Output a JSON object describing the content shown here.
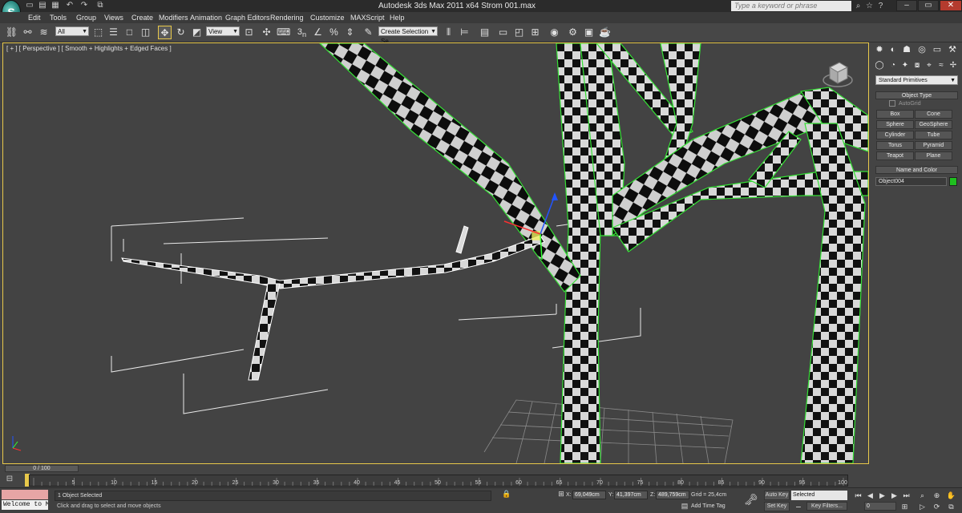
{
  "window": {
    "title": "Autodesk 3ds Max 2011 x64     Strom 001.max",
    "search_placeholder": "Type a keyword or phrase",
    "app_logo_letter": "S"
  },
  "menu": [
    "Edit",
    "Tools",
    "Group",
    "Views",
    "Create",
    "Modifiers",
    "Animation",
    "Graph Editors",
    "Rendering",
    "Customize",
    "MAXScript",
    "Help"
  ],
  "toolbar": {
    "selection_filter": "All",
    "ref_coord": "View",
    "named_selection": "Create Selection Se",
    "snap_label": "3",
    "snap_sub": "n"
  },
  "viewport": {
    "label": "[ + ] [ Perspective ] [ Smooth + Highlights + Edged Faces ]",
    "border_color": "#e8c84a"
  },
  "command_panel": {
    "category": "Standard Primitives",
    "object_type_header": "Object Type",
    "autogrid": "AutoGrid",
    "buttons": [
      "Box",
      "Cone",
      "Sphere",
      "GeoSphere",
      "Cylinder",
      "Tube",
      "Torus",
      "Pyramid",
      "Teapot",
      "Plane"
    ],
    "name_color_header": "Name and Color",
    "object_name": "Object004",
    "object_color": "#1fbf1f"
  },
  "timeline": {
    "slider": "0 / 100",
    "ticks": [
      "5",
      "10",
      "15",
      "20",
      "25",
      "30",
      "35",
      "40",
      "45",
      "50",
      "55",
      "60",
      "65",
      "70",
      "75",
      "80",
      "85",
      "90",
      "95",
      "100"
    ]
  },
  "status": {
    "listener_text": "Welcome to M(",
    "selection_count": "1 Object Selected",
    "prompt": "Click and drag to select and move objects",
    "x_label": "X:",
    "x_value": "69,049cm",
    "y_label": "Y:",
    "y_value": "41,397cm",
    "z_label": "Z:",
    "z_value": "489,759cm",
    "grid": "Grid = 25,4cm",
    "add_time_tag": "Add Time Tag",
    "auto_key": "Auto Key",
    "set_key": "Set Key",
    "key_mode": "Selected",
    "key_filters": "Key Filters...",
    "frame": "0"
  }
}
